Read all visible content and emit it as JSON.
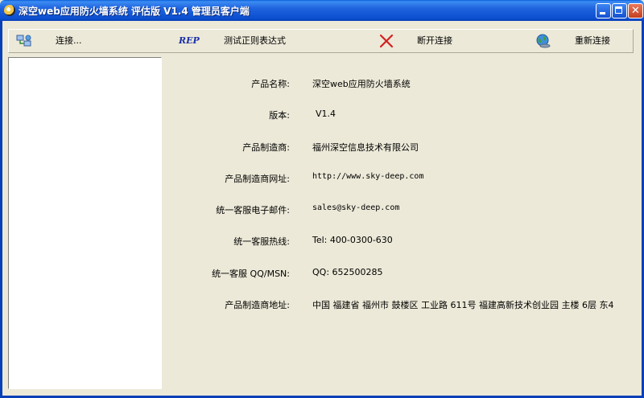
{
  "window": {
    "title": "深空web应用防火墙系统 评估版 V1.4 管理员客户端"
  },
  "toolbar": {
    "connect_label": "连接...",
    "rep_label": "REP",
    "regex_test_label": "测试正则表达式",
    "disconnect_label": "断开连接",
    "reconnect_label": "重新连接"
  },
  "info": {
    "product_name": {
      "label": "产品名称:",
      "value": "深空web应用防火墙系统"
    },
    "version": {
      "label": "版本:",
      "value": "V1.4"
    },
    "manufacturer": {
      "label": "产品制造商:",
      "value": "福州深空信息技术有限公司"
    },
    "website": {
      "label": "产品制造商网址:",
      "value": "http://www.sky-deep.com"
    },
    "email": {
      "label": "统一客服电子邮件:",
      "value": "sales@sky-deep.com"
    },
    "hotline": {
      "label": "统一客服热线:",
      "value": "Tel: 400-0300-630"
    },
    "qq": {
      "label": "统一客服 QQ/MSN:",
      "value": "QQ: 652500285"
    },
    "address": {
      "label": "产品制造商地址:",
      "value": "中国 福建省 福州市 鼓楼区 工业路 611号 福建高新技术创业园 主楼 6层 东4"
    }
  },
  "colors": {
    "title_bar": "#0b4fd0",
    "window_bg": "#ece9d8",
    "close_button": "#c3401f",
    "disconnect_x": "#d42020"
  },
  "icons": [
    "network-connect-icon",
    "disconnect-x-icon",
    "globe-reconnect-icon"
  ]
}
